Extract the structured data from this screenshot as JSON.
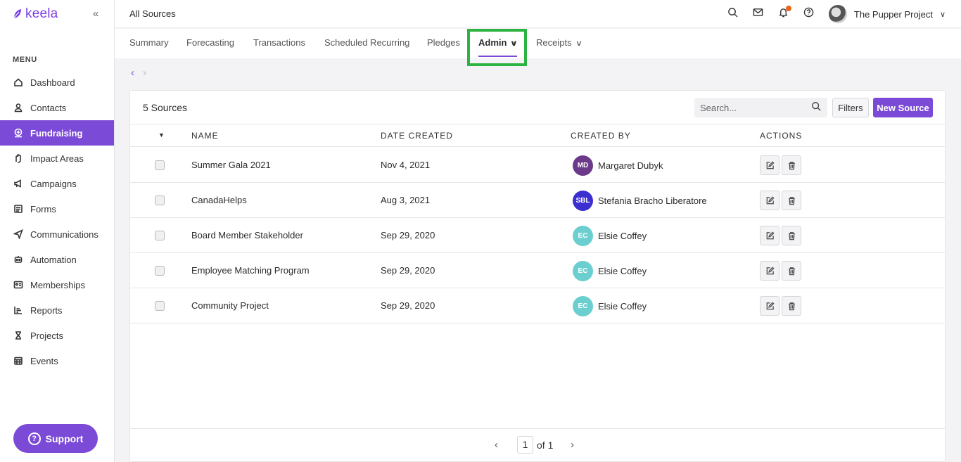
{
  "brand": {
    "name": "keela",
    "collapse_glyph": "«"
  },
  "sidebar": {
    "menu_title": "MENU",
    "items": [
      {
        "label": "Dashboard",
        "icon": "home-icon"
      },
      {
        "label": "Contacts",
        "icon": "user-icon"
      },
      {
        "label": "Fundraising",
        "icon": "fundraising-icon",
        "active": true
      },
      {
        "label": "Impact Areas",
        "icon": "hand-icon"
      },
      {
        "label": "Campaigns",
        "icon": "megaphone-icon"
      },
      {
        "label": "Forms",
        "icon": "form-icon"
      },
      {
        "label": "Communications",
        "icon": "send-icon"
      },
      {
        "label": "Automation",
        "icon": "robot-icon"
      },
      {
        "label": "Memberships",
        "icon": "id-card-icon"
      },
      {
        "label": "Reports",
        "icon": "chart-icon"
      },
      {
        "label": "Projects",
        "icon": "hourglass-icon"
      },
      {
        "label": "Events",
        "icon": "calendar-icon"
      }
    ],
    "support_label": "Support"
  },
  "header": {
    "title": "All Sources",
    "org_name": "The Pupper Project"
  },
  "tabs": [
    {
      "label": "Summary"
    },
    {
      "label": "Forecasting"
    },
    {
      "label": "Transactions"
    },
    {
      "label": "Scheduled Recurring"
    },
    {
      "label": "Pledges"
    },
    {
      "label": "Admin",
      "active": true
    },
    {
      "label": "Receipts"
    }
  ],
  "table": {
    "count_label": "5 Sources",
    "search_placeholder": "Search...",
    "filters_label": "Filters",
    "new_label": "New Source",
    "columns": [
      "NAME",
      "DATE CREATED",
      "CREATED BY",
      "ACTIONS"
    ],
    "rows": [
      {
        "name": "Summer Gala 2021",
        "date": "Nov 4, 2021",
        "initials": "MD",
        "creator": "Margaret Dubyk",
        "color": "#6b3a8a"
      },
      {
        "name": "CanadaHelps",
        "date": "Aug 3, 2021",
        "initials": "SBL",
        "creator": "Stefania Bracho Liberatore",
        "color": "#3b2fd0"
      },
      {
        "name": "Board Member Stakeholder",
        "date": "Sep 29, 2020",
        "initials": "EC",
        "creator": "Elsie Coffey",
        "color": "#6ccfcf"
      },
      {
        "name": "Employee Matching Program",
        "date": "Sep 29, 2020",
        "initials": "EC",
        "creator": "Elsie Coffey",
        "color": "#6ccfcf"
      },
      {
        "name": "Community Project",
        "date": "Sep 29, 2020",
        "initials": "EC",
        "creator": "Elsie Coffey",
        "color": "#6ccfcf"
      }
    ]
  },
  "pager": {
    "page": "1",
    "of_label": "of 1"
  },
  "colors": {
    "accent": "#7b4ad6",
    "highlight": "#2db341",
    "notification": "#e8641b"
  }
}
